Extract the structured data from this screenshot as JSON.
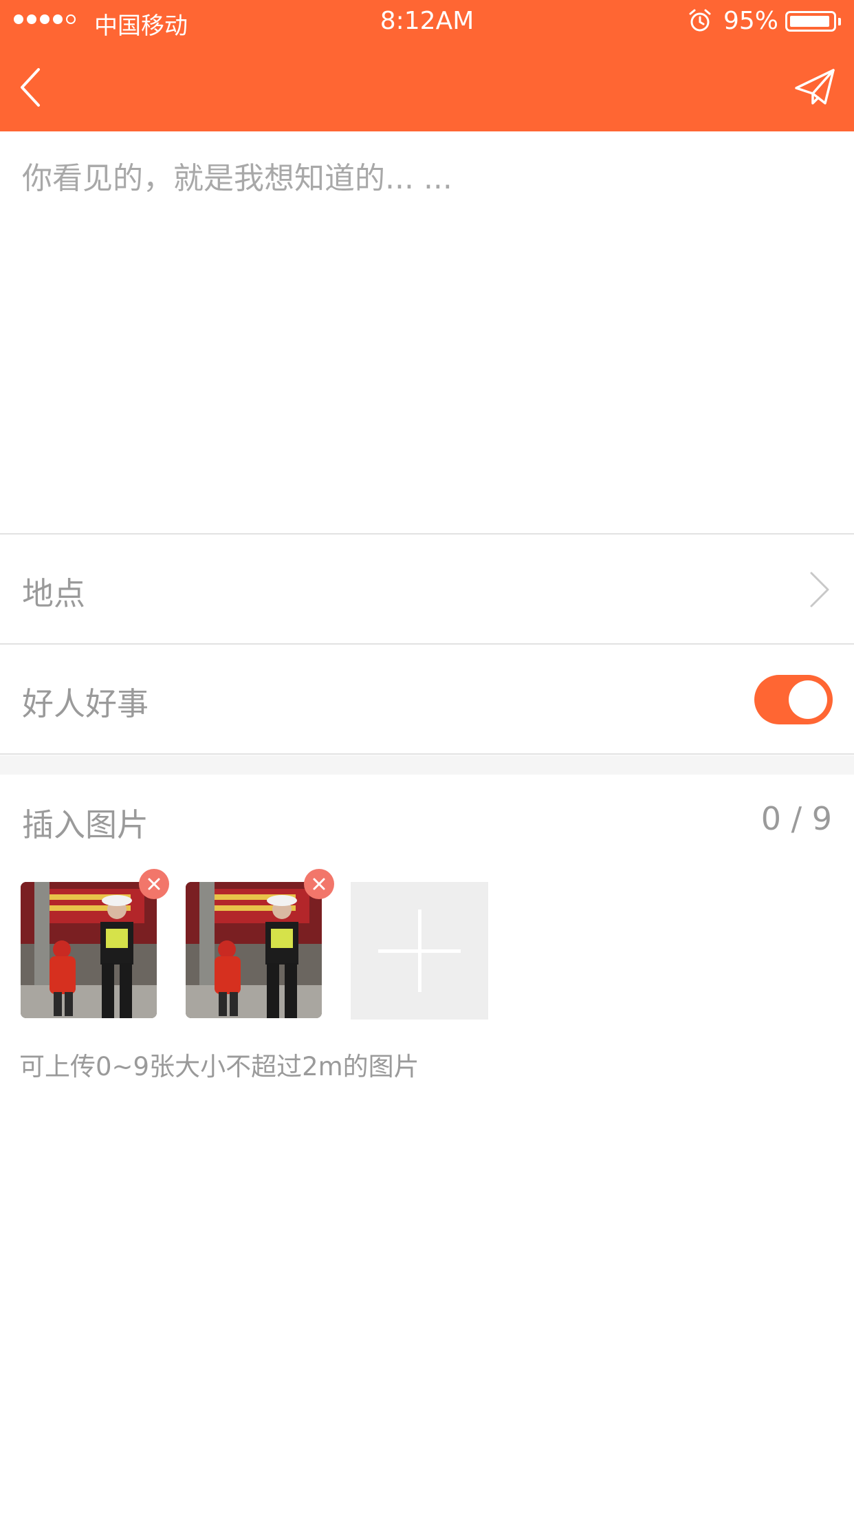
{
  "status_bar": {
    "carrier": "中国移动",
    "time": "8:12AM",
    "battery_percent": "95%",
    "battery_level": 0.95,
    "signal_bars_filled": 4,
    "signal_bars_total": 5
  },
  "header": {
    "back_icon": "chevron-left-icon",
    "send_icon": "paper-plane-icon",
    "background_color": "#FF6633"
  },
  "compose": {
    "placeholder": "你看见的，就是我想知道的... ..."
  },
  "location_row": {
    "label": "地点",
    "icon": "chevron-right-icon"
  },
  "good_deeds_row": {
    "label": "好人好事",
    "toggle_on": true
  },
  "images": {
    "title": "插入图片",
    "count": "0 / 9",
    "thumbnails": [
      {
        "remove_icon": "close-icon"
      },
      {
        "remove_icon": "close-icon"
      }
    ],
    "add_icon": "plus-icon",
    "hint": "可上传0~9张大小不超过2m的图片"
  }
}
